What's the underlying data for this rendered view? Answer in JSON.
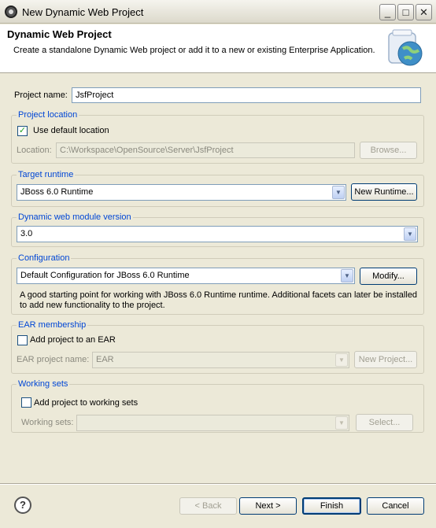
{
  "window": {
    "title": "New Dynamic Web Project",
    "min_glyph": "_",
    "max_glyph": "□",
    "close_glyph": "✕"
  },
  "banner": {
    "title": "Dynamic Web Project",
    "description": "Create a standalone Dynamic Web project or add it to a new or existing Enterprise Application."
  },
  "project_name": {
    "label": "Project name:",
    "value": "JsfProject"
  },
  "project_location": {
    "group_title": "Project location",
    "use_default_label": "Use default location",
    "use_default_checked": true,
    "location_label": "Location:",
    "location_value": "C:\\Workspace\\OpenSource\\Server\\JsfProject",
    "browse_label": "Browse..."
  },
  "target_runtime": {
    "group_title": "Target runtime",
    "selected": "JBoss 6.0 Runtime",
    "new_runtime_label": "New Runtime..."
  },
  "module_version": {
    "group_title": "Dynamic web module version",
    "selected": "3.0"
  },
  "configuration": {
    "group_title": "Configuration",
    "selected": "Default Configuration for JBoss 6.0 Runtime",
    "modify_label": "Modify...",
    "description_line1": "A good starting point for working with JBoss 6.0 Runtime runtime. Additional facets can later be installed",
    "description_line2": "to add new functionality to the project."
  },
  "ear": {
    "group_title": "EAR membership",
    "add_label": "Add project to an EAR",
    "add_checked": false,
    "project_name_label": "EAR project name:",
    "project_name_value": "EAR",
    "new_project_label": "New Project..."
  },
  "working_sets": {
    "group_title": "Working sets",
    "add_label": "Add project to working sets",
    "add_checked": false,
    "sets_label": "Working sets:",
    "sets_value": "",
    "select_label": "Select..."
  },
  "footer": {
    "help_glyph": "?",
    "back_label": "< Back",
    "next_label": "Next >",
    "finish_label": "Finish",
    "cancel_label": "Cancel"
  }
}
